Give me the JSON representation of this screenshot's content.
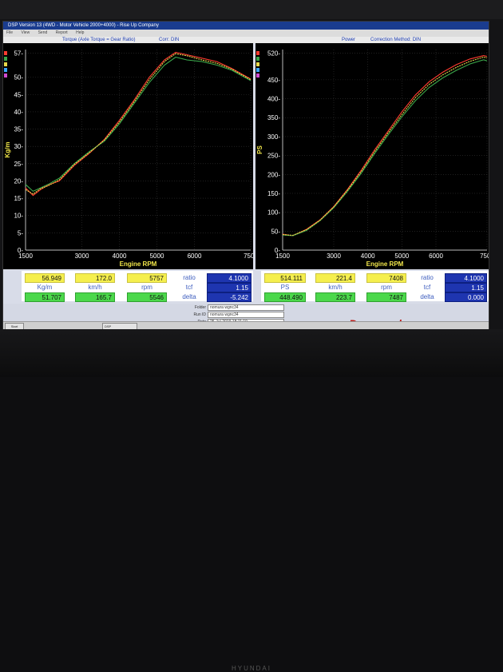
{
  "window": {
    "title": "DSP Version 13 (4WD - Motor Vehicle 2000+4000) - Rise Up Company",
    "menu": [
      "File",
      "View",
      "Send",
      "Report",
      "Help"
    ]
  },
  "infobar": {
    "left_title": "Torque (Axle Torque = Gear Ratio)",
    "corr": "Corr: DIN",
    "power": "Power",
    "correction": "Correction Method: DIN"
  },
  "colors": {
    "run1": "#ff3b30",
    "run2": "#3aa64a",
    "run3": "#e8d84a"
  },
  "chart_data": [
    {
      "type": "line",
      "ylabel": "Kg/m",
      "xlabel": "Engine RPM",
      "xlim": [
        1500,
        7500
      ],
      "ylim": [
        0,
        58
      ],
      "x_ticks": [
        "1500",
        "3000",
        "4000",
        "5000",
        "6000",
        "7500"
      ],
      "x_tick_values": [
        1500,
        3000,
        4000,
        5000,
        6000,
        7500
      ],
      "y_ticks": [
        "0-",
        "5-",
        "10-",
        "15-",
        "20-",
        "25-",
        "30-",
        "35-",
        "40-",
        "45-",
        "50-",
        "57-"
      ],
      "y_tick_values": [
        0,
        5,
        10,
        15,
        20,
        25,
        30,
        35,
        40,
        45,
        50,
        57
      ],
      "x": [
        1500,
        1700,
        1900,
        2100,
        2400,
        2800,
        3200,
        3600,
        4000,
        4400,
        4800,
        5200,
        5500,
        5800,
        6200,
        6600,
        7000,
        7500
      ],
      "series": [
        {
          "color": "#ff3b30",
          "values": [
            18.0,
            15.8,
            17.5,
            18.8,
            20.0,
            24.5,
            28.0,
            32.0,
            37.5,
            43.5,
            50.0,
            55.0,
            57.2,
            56.5,
            55.5,
            54.5,
            52.5,
            49.5
          ]
        },
        {
          "color": "#3aa64a",
          "values": [
            19.0,
            17.0,
            18.0,
            19.0,
            20.8,
            25.0,
            28.5,
            31.5,
            36.5,
            42.5,
            48.5,
            53.5,
            55.8,
            55.0,
            54.5,
            53.5,
            52.0,
            49.0
          ]
        },
        {
          "color": "#e8d84a",
          "values": [
            17.5,
            16.2,
            17.8,
            18.6,
            20.3,
            24.8,
            28.2,
            31.8,
            37.0,
            43.0,
            49.3,
            54.5,
            56.8,
            56.2,
            55.0,
            54.0,
            52.3,
            49.3
          ]
        }
      ]
    },
    {
      "type": "line",
      "ylabel": "PS",
      "xlabel": "Engine RPM",
      "xlim": [
        1500,
        7500
      ],
      "ylim": [
        0,
        530
      ],
      "x_ticks": [
        "1500",
        "3000",
        "4000",
        "5000",
        "6000",
        "7500"
      ],
      "x_tick_values": [
        1500,
        3000,
        4000,
        5000,
        6000,
        7500
      ],
      "y_ticks": [
        "0-",
        "50-",
        "100-",
        "150-",
        "200-",
        "250-",
        "300-",
        "350-",
        "400-",
        "450-",
        "520-"
      ],
      "y_tick_values": [
        0,
        50,
        100,
        150,
        200,
        250,
        300,
        350,
        400,
        450,
        520
      ],
      "x": [
        1500,
        1800,
        2200,
        2600,
        3000,
        3400,
        3800,
        4200,
        4600,
        5000,
        5400,
        5800,
        6200,
        6600,
        7000,
        7400,
        7500
      ],
      "series": [
        {
          "color": "#ff3b30",
          "values": [
            42,
            38,
            55,
            80,
            115,
            160,
            210,
            265,
            315,
            365,
            410,
            445,
            470,
            490,
            505,
            514,
            512
          ]
        },
        {
          "color": "#3aa64a",
          "values": [
            40,
            38,
            52,
            78,
            112,
            155,
            202,
            255,
            305,
            352,
            395,
            430,
            455,
            475,
            492,
            503,
            500
          ]
        },
        {
          "color": "#e8d84a",
          "values": [
            41,
            39,
            54,
            79,
            114,
            158,
            206,
            260,
            310,
            358,
            403,
            438,
            463,
            483,
            499,
            510,
            508
          ]
        }
      ]
    }
  ],
  "panel_left": {
    "row1": {
      "v1": "56.949",
      "v2": "172.0",
      "v3": "5757",
      "ratio_label": "ratio",
      "ratio": "4.1000"
    },
    "row2": {
      "u1": "Kg/m",
      "u2": "km/h",
      "u3": "rpm",
      "tcf_label": "tcf",
      "tcf": "1.15"
    },
    "row3": {
      "v1": "51.707",
      "v2": "165.7",
      "v3": "5546",
      "delta_label": "delta",
      "delta": "-5.242"
    }
  },
  "panel_right": {
    "row1": {
      "v1": "514.111",
      "v2": "221.4",
      "v3": "7408",
      "ratio_label": "ratio",
      "ratio": "4.1000"
    },
    "row2": {
      "u1": "PS",
      "u2": "km/h",
      "u3": "rpm",
      "tcf_label": "tcf",
      "tcf": "1.15"
    },
    "row3": {
      "v1": "448.490",
      "v2": "223.7",
      "v3": "7487",
      "delta_label": "delta",
      "delta": "0.000"
    }
  },
  "info": {
    "folder_label": "Folder",
    "folder": "nomura wgnc34",
    "runid_label": "Run ID",
    "runid": "nomura wgnc34",
    "date_label": "Date",
    "date": "25-Jul-2019 18:11:19"
  },
  "logo": "Dynapack",
  "monitor_brand": "HYUNDAI",
  "taskbar": {
    "start": "Start",
    "app": "DSP"
  }
}
